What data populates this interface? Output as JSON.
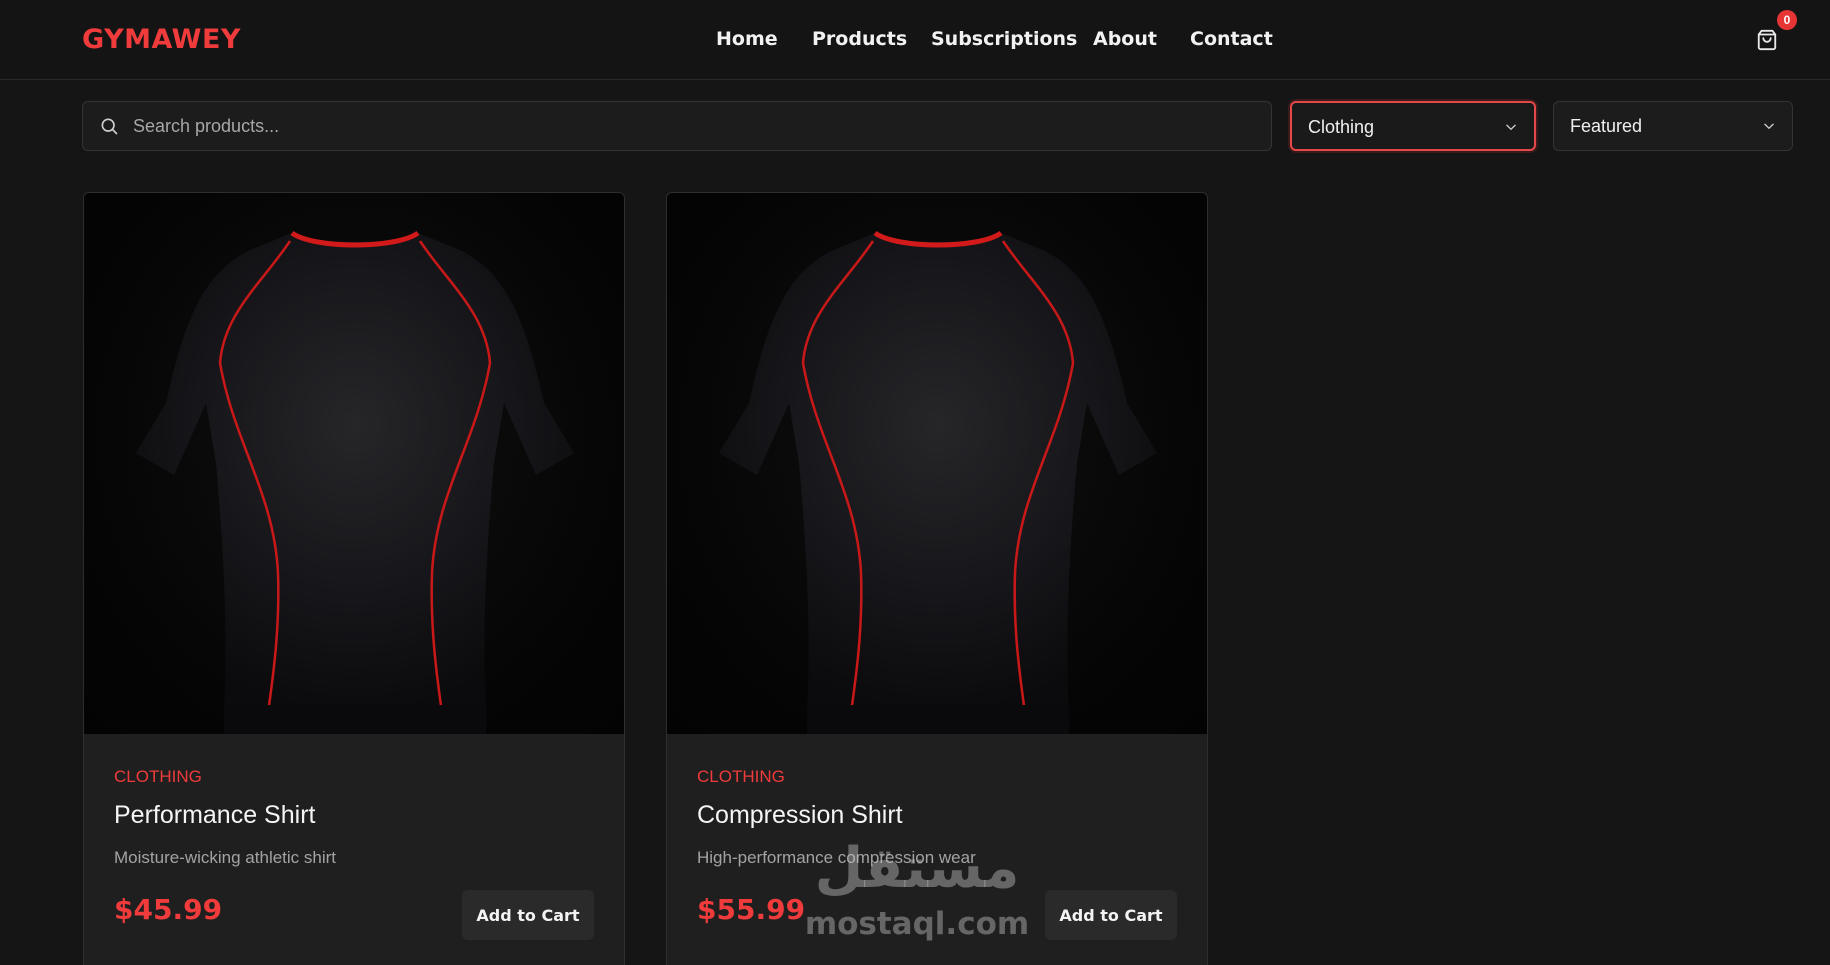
{
  "brand": {
    "name": "GYMAWEY",
    "accent": "#ef3b3b"
  },
  "nav": {
    "items": [
      {
        "label": "Home"
      },
      {
        "label": "Products"
      },
      {
        "label": "Subscriptions"
      },
      {
        "label": "About"
      },
      {
        "label": "Contact"
      }
    ]
  },
  "cart": {
    "icon": "shopping-bag-icon",
    "count": "0"
  },
  "filters": {
    "search": {
      "placeholder": "Search products...",
      "value": "",
      "icon": "search-icon"
    },
    "category": {
      "selected": "Clothing",
      "icon": "chevron-down-icon"
    },
    "sort": {
      "selected": "Featured",
      "icon": "chevron-down-icon"
    }
  },
  "products": [
    {
      "category": "CLOTHING",
      "name": "Performance Shirt",
      "description": "Moisture-wicking athletic shirt",
      "price": "$45.99",
      "button_label": "Add to Cart",
      "image": "black-athletic-shirt-red-piping"
    },
    {
      "category": "CLOTHING",
      "name": "Compression Shirt",
      "description": "High-performance compression wear",
      "price": "$55.99",
      "button_label": "Add to Cart",
      "image": "black-athletic-shirt-red-piping"
    }
  ],
  "watermark": {
    "arabic": "مستقل",
    "latin": "mostaql.com"
  }
}
